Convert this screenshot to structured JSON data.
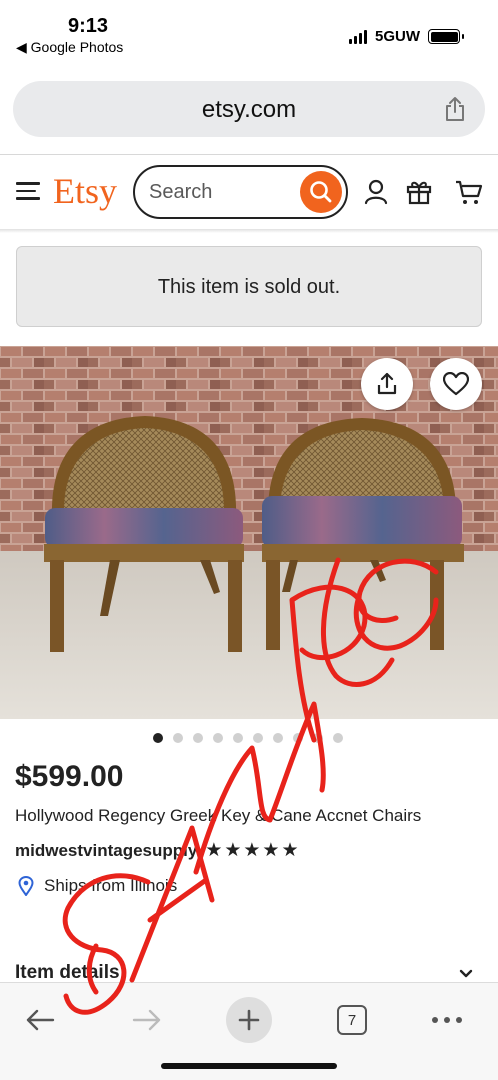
{
  "status_bar": {
    "time": "9:13",
    "back_label": "◀ Google Photos",
    "network": "5GUW"
  },
  "browser": {
    "url": "etsy.com",
    "icons": [
      "share-icon"
    ],
    "nav": {
      "tab_count": "7",
      "icons": [
        "back-arrow-icon",
        "forward-arrow-icon",
        "plus-icon",
        "tabs-icon",
        "more-icon"
      ]
    }
  },
  "header": {
    "logo": "Etsy",
    "search_placeholder": "Search",
    "icons": [
      "hamburger-icon",
      "search-icon",
      "user-icon",
      "gift-icon",
      "cart-icon"
    ]
  },
  "notice": {
    "sold_out": "This item is sold out."
  },
  "listing": {
    "price": "$599.00",
    "title": "Hollywood Regency Greek Key & Cane Accnet Chairs",
    "shop": "midwestvintagesupply",
    "rating_stars": 5,
    "stars_text": "★★★★★",
    "ships": "Ships from Illinois",
    "photo_count": 10,
    "active_photo": 1,
    "item_details_label": "Item details"
  },
  "overlay": {
    "watermark": "SAMPLE",
    "color": "#e8231b"
  },
  "colors": {
    "brand": "#f1641e",
    "text": "#222222"
  }
}
